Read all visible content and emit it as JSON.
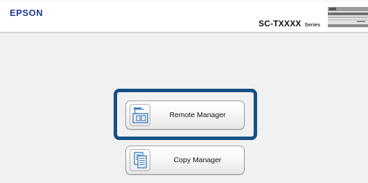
{
  "header": {
    "brand": "EPSON",
    "model_name": "SC-TXXXX",
    "model_suffix": "Series"
  },
  "buttons": {
    "remote_manager": {
      "label": "Remote Manager",
      "icon": "remote-manager-icon"
    },
    "copy_manager": {
      "label": "Copy Manager",
      "icon": "copy-manager-icon"
    }
  },
  "colors": {
    "brand": "#1a3b8f",
    "highlight": "#165085",
    "icon_blue": "#3f7fbf",
    "background": "#f1f1f1"
  }
}
